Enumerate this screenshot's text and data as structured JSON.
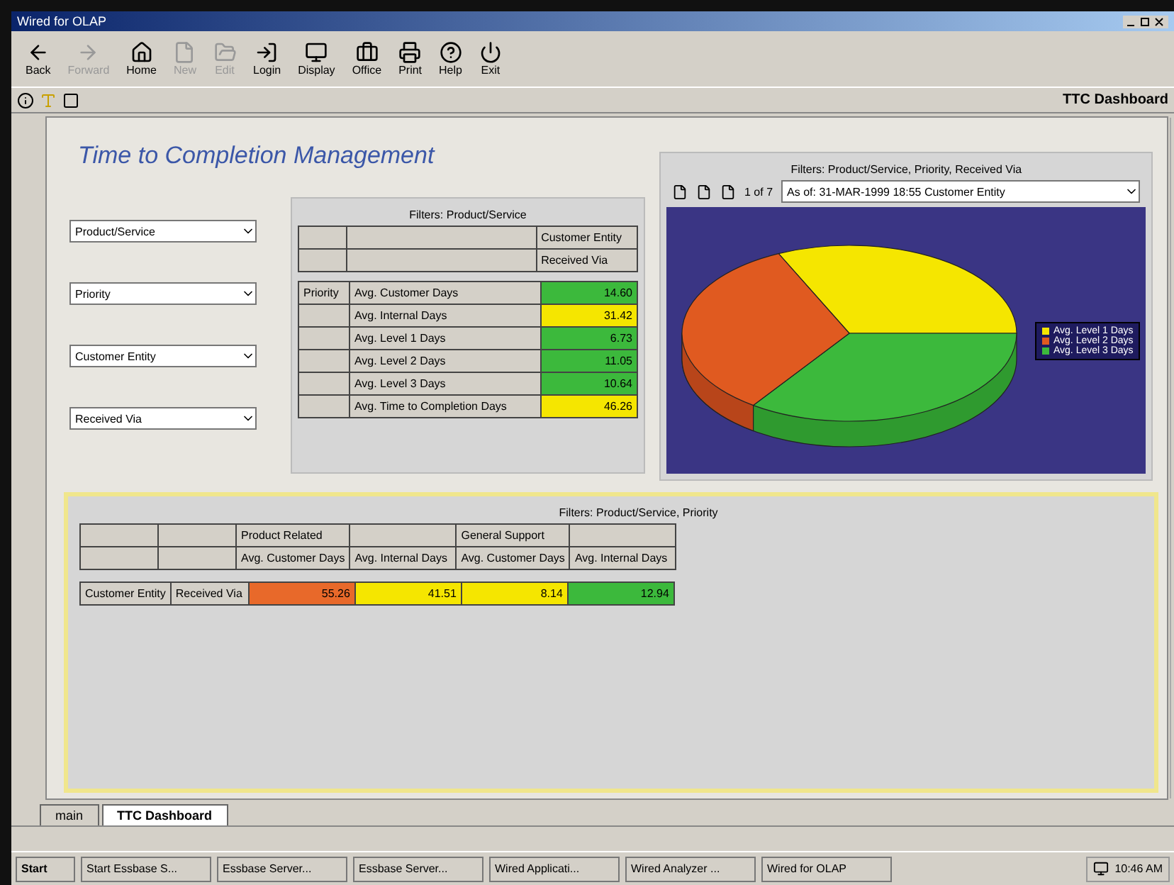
{
  "window": {
    "title": "Wired for OLAP"
  },
  "toolbar": [
    {
      "label": "Back",
      "disabled": false
    },
    {
      "label": "Forward",
      "disabled": true
    },
    {
      "label": "Home",
      "disabled": false
    },
    {
      "label": "New",
      "disabled": true
    },
    {
      "label": "Edit",
      "disabled": true
    },
    {
      "label": "Login",
      "disabled": false
    },
    {
      "label": "Display",
      "disabled": false
    },
    {
      "label": "Office",
      "disabled": false
    },
    {
      "label": "Print",
      "disabled": false
    },
    {
      "label": "Help",
      "disabled": false
    },
    {
      "label": "Exit",
      "disabled": false
    }
  ],
  "view_title": "TTC Dashboard",
  "page_title": "Time to Completion Management",
  "filters": [
    {
      "value": "Product/Service"
    },
    {
      "value": "Priority"
    },
    {
      "value": "Customer Entity"
    },
    {
      "value": "Received Via"
    }
  ],
  "summary_grid": {
    "caption": "Filters: Product/Service",
    "header_rows": [
      "Customer Entity",
      "Received Via"
    ],
    "row_label": "Priority",
    "rows": [
      {
        "label": "Avg. Customer Days",
        "value": "14.60",
        "color": "#3cb93c"
      },
      {
        "label": "Avg. Internal Days",
        "value": "31.42",
        "color": "#f5e600"
      },
      {
        "label": "Avg. Level 1 Days",
        "value": "6.73",
        "color": "#3cb93c"
      },
      {
        "label": "Avg. Level 2 Days",
        "value": "11.05",
        "color": "#3cb93c"
      },
      {
        "label": "Avg. Level 3 Days",
        "value": "10.64",
        "color": "#3cb93c"
      },
      {
        "label": "Avg. Time to Completion Days",
        "value": "46.26",
        "color": "#f5e600"
      }
    ]
  },
  "chart_panel": {
    "caption": "Filters: Product/Service, Priority, Received Via",
    "page": "1 of 7",
    "selector": "As of: 31-MAR-1999 18:55 Customer Entity",
    "legend": [
      {
        "label": "Avg. Level 1 Days",
        "color": "#f5e600"
      },
      {
        "label": "Avg. Level 2 Days",
        "color": "#e05a20"
      },
      {
        "label": "Avg. Level 3 Days",
        "color": "#3cb93c"
      }
    ]
  },
  "detail_grid": {
    "caption": "Filters: Product/Service, Priority",
    "header_rows": [
      [
        "",
        "",
        "Product Related",
        "",
        "General Support",
        ""
      ],
      [
        "",
        "",
        "Avg. Customer Days",
        "Avg. Internal Days",
        "Avg. Customer Days",
        "Avg. Internal Days"
      ]
    ],
    "row_labels": [
      "Customer Entity",
      "Received Via"
    ],
    "values": [
      {
        "value": "55.26",
        "color": "#e8692a"
      },
      {
        "value": "41.51",
        "color": "#f5e600"
      },
      {
        "value": "8.14",
        "color": "#f5e600"
      },
      {
        "value": "12.94",
        "color": "#3cb93c"
      }
    ]
  },
  "tabs": [
    {
      "label": "main",
      "selected": false
    },
    {
      "label": "TTC Dashboard",
      "selected": true
    }
  ],
  "taskbar": {
    "start": "Start",
    "items": [
      "Start Essbase S...",
      "Essbase Server...",
      "Essbase Server...",
      "Wired Applicati...",
      "Wired Analyzer ...",
      "Wired for OLAP"
    ],
    "clock": "10:46 AM"
  }
}
